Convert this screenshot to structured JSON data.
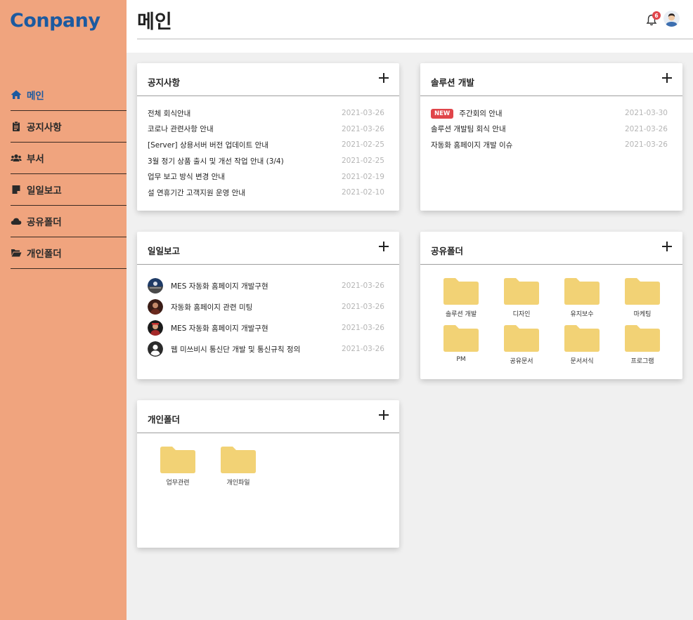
{
  "brand": {
    "logo_text": "Conpany",
    "logo_color": "#1c5aa0",
    "sidebar_color": "#f0a47e"
  },
  "sidebar": {
    "items": [
      {
        "label": "메인",
        "icon": "home-icon",
        "active": true
      },
      {
        "label": "공지사항",
        "icon": "clipboard-icon",
        "active": false
      },
      {
        "label": "부서",
        "icon": "users-icon",
        "active": false
      },
      {
        "label": "일일보고",
        "icon": "note-icon",
        "active": false
      },
      {
        "label": "공유폴더",
        "icon": "cloud-icon",
        "active": false
      },
      {
        "label": "개인폴더",
        "icon": "folder-open-icon",
        "active": false
      }
    ]
  },
  "header": {
    "title": "메인",
    "notification_count": "6",
    "bell_icon": "bell-icon",
    "avatar_icon": "user-avatar"
  },
  "notice": {
    "title": "공지사항",
    "items": [
      {
        "text": "전체 회식안내",
        "date": "2021-03-26"
      },
      {
        "text": "코로나 관련사항 안내",
        "date": "2021-03-26"
      },
      {
        "text": "[Server] 상용서버 버전 업데이트 안내",
        "date": "2021-02-25"
      },
      {
        "text": "3월 정기 상품 출시 및 개선 작업 안내 (3/4)",
        "date": "2021-02-25"
      },
      {
        "text": "업무 보고 방식 변경 안내",
        "date": "2021-02-19"
      },
      {
        "text": "설 연휴기간 고객지원 운영 안내",
        "date": "2021-02-10"
      }
    ]
  },
  "solution": {
    "title": "솔루션 개발",
    "new_label": "NEW",
    "items": [
      {
        "text": "주간회의 안내",
        "date": "2021-03-30",
        "is_new": true
      },
      {
        "text": "솔루션 개발팀 회식 안내",
        "date": "2021-03-26",
        "is_new": false
      },
      {
        "text": "자동화 홈페이지 개발 이슈",
        "date": "2021-03-26",
        "is_new": false
      }
    ]
  },
  "daily": {
    "title": "일일보고",
    "items": [
      {
        "text": "MES 자동화 홈페이지 개발구현",
        "date": "2021-03-26",
        "avatar": "photo-1"
      },
      {
        "text": "자동화 홈페이지 관련 미팅",
        "date": "2021-03-26",
        "avatar": "photo-2"
      },
      {
        "text": "MES 자동화 홈페이지 개발구현",
        "date": "2021-03-26",
        "avatar": "photo-3"
      },
      {
        "text": "웹 미쓰비시 통신단 개발 및 통신규칙 정의",
        "date": "2021-03-26",
        "avatar": "default-user-icon"
      }
    ]
  },
  "shared": {
    "title": "공유폴더",
    "folders": [
      "솔루션 개발",
      "디자인",
      "유지보수",
      "마케팅",
      "PM",
      "공유문서",
      "문서서식",
      "프로그램"
    ]
  },
  "personal": {
    "title": "개인폴더",
    "folders": [
      "업무관련",
      "개인파일"
    ]
  },
  "colors": {
    "folder": "#f2d275",
    "badge_red": "#e0454a",
    "date_gray": "#b5b5b5"
  }
}
